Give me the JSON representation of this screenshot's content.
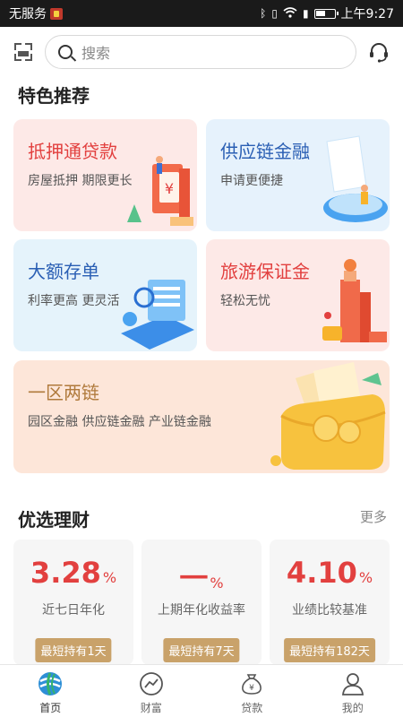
{
  "status_bar": {
    "carrier": "无服务",
    "time": "上午9:27"
  },
  "header": {
    "search_placeholder": "搜索",
    "icons": [
      "scan-icon",
      "search-icon",
      "customer-service-icon"
    ]
  },
  "featured": {
    "title": "特色推荐",
    "cards": [
      {
        "title": "抵押通贷款",
        "subtitle": "房屋抵押 期限更长",
        "title_color": "#e2403f",
        "bg": "#fde9e7"
      },
      {
        "title": "供应链金融",
        "subtitle": "申请更便捷",
        "title_color": "#2a5fb4",
        "bg": "#e6f2fc"
      },
      {
        "title": "大额存单",
        "subtitle": "利率更高 更灵活",
        "title_color": "#2a5fb4",
        "bg": "#e5f3fb"
      },
      {
        "title": "旅游保证金",
        "subtitle": "轻松无忧",
        "title_color": "#e2403f",
        "bg": "#fde9e7"
      },
      {
        "title": "一区两链",
        "subtitle": "园区金融 供应链金融 产业链金融",
        "title_color": "#b07a3c",
        "bg": "#fde6d9"
      }
    ]
  },
  "wealth": {
    "title": "优选理财",
    "more": "更多",
    "products": [
      {
        "rate": "3.28",
        "unit": "%",
        "desc": "近七日年化",
        "tag": "最短持有1天"
      },
      {
        "rate": "一",
        "unit": "%",
        "desc": "上期年化收益率",
        "tag": "最短持有7天"
      },
      {
        "rate": "4.10",
        "unit": "%",
        "desc": "业绩比较基准",
        "tag": "最短持有182天"
      }
    ]
  },
  "tabs": [
    {
      "label": "首页",
      "icon": "home-logo-icon",
      "active": true
    },
    {
      "label": "财富",
      "icon": "wealth-chart-icon",
      "active": false
    },
    {
      "label": "贷款",
      "icon": "loan-bag-icon",
      "active": false
    },
    {
      "label": "我的",
      "icon": "profile-icon",
      "active": false
    }
  ]
}
